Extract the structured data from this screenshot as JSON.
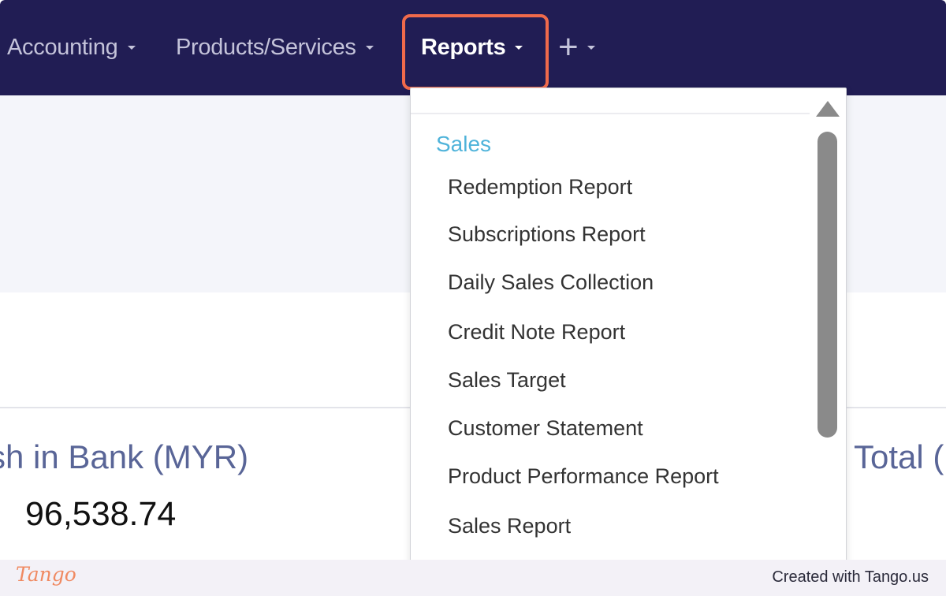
{
  "nav": {
    "items": [
      {
        "label": "Accounting"
      },
      {
        "label": "Products/Services"
      },
      {
        "label": "Reports"
      },
      {
        "label": "+"
      }
    ]
  },
  "dashboard": {
    "cash_label": "sh in Bank (MYR)",
    "cash_value": "96,538.74",
    "total_label": "Total ("
  },
  "dropdown": {
    "section": "Sales",
    "items": [
      "Redemption Report",
      "Subscriptions Report",
      "Daily Sales Collection",
      "Credit Note Report",
      "Sales Target",
      "Customer Statement",
      "Product Performance Report",
      "Sales Report"
    ]
  },
  "footer": {
    "logo": "Tango",
    "credit": "Created with Tango.us"
  },
  "colors": {
    "navbar": "#211d54",
    "highlight": "#f06a4b",
    "section_heading": "#4fb3da"
  }
}
